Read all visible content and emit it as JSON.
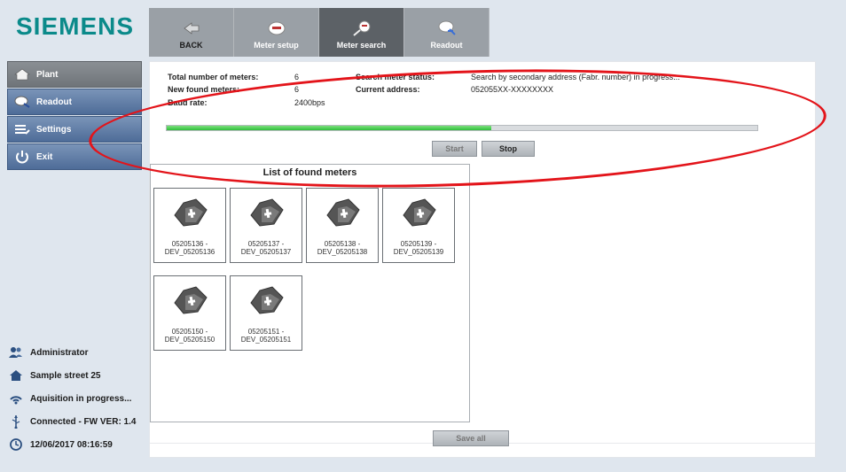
{
  "brand": "SIEMENS",
  "topnav": [
    {
      "label": "BACK",
      "icon": "back-arrow-icon"
    },
    {
      "label": "Meter setup",
      "icon": "meter-setup-icon"
    },
    {
      "label": "Meter search",
      "icon": "meter-search-icon"
    },
    {
      "label": "Readout",
      "icon": "readout-icon"
    }
  ],
  "sidebar": {
    "items": [
      {
        "label": "Plant"
      },
      {
        "label": "Readout"
      },
      {
        "label": "Settings"
      },
      {
        "label": "Exit"
      }
    ]
  },
  "status": {
    "user": "Administrator",
    "address": "Sample street 25",
    "acquisition": "Aquisition in progress...",
    "connection": "Connected - FW VER: 1.4",
    "datetime": "12/06/2017 08:16:59"
  },
  "info": {
    "total_label": "Total number of meters:",
    "total_value": "6",
    "new_label": "New found meters:",
    "new_value": "6",
    "baud_label": "Baud rate:",
    "baud_value": "2400bps",
    "search_status_label": "Search meter status:",
    "search_status_value": "Search by secondary address (Fabr. number) in progress...",
    "current_address_label": "Current address:",
    "current_address_value": "052055XX-XXXXXXXX"
  },
  "progress": {
    "fraction": 0.55
  },
  "buttons": {
    "start": "Start",
    "stop": "Stop",
    "save_all": "Save all"
  },
  "list": {
    "title": "List of found meters",
    "meters": [
      {
        "line1": "05205136 -",
        "line2": "DEV_05205136"
      },
      {
        "line1": "05205137 -",
        "line2": "DEV_05205137"
      },
      {
        "line1": "05205138 -",
        "line2": "DEV_05205138"
      },
      {
        "line1": "05205139 -",
        "line2": "DEV_05205139"
      },
      {
        "line1": "05205150 -",
        "line2": "DEV_05205150"
      },
      {
        "line1": "05205151 -",
        "line2": "DEV_05205151"
      }
    ]
  },
  "colors": {
    "brand": "#0b8a8a",
    "progress": "#2fbf3a",
    "annotation": "#e3141a"
  }
}
